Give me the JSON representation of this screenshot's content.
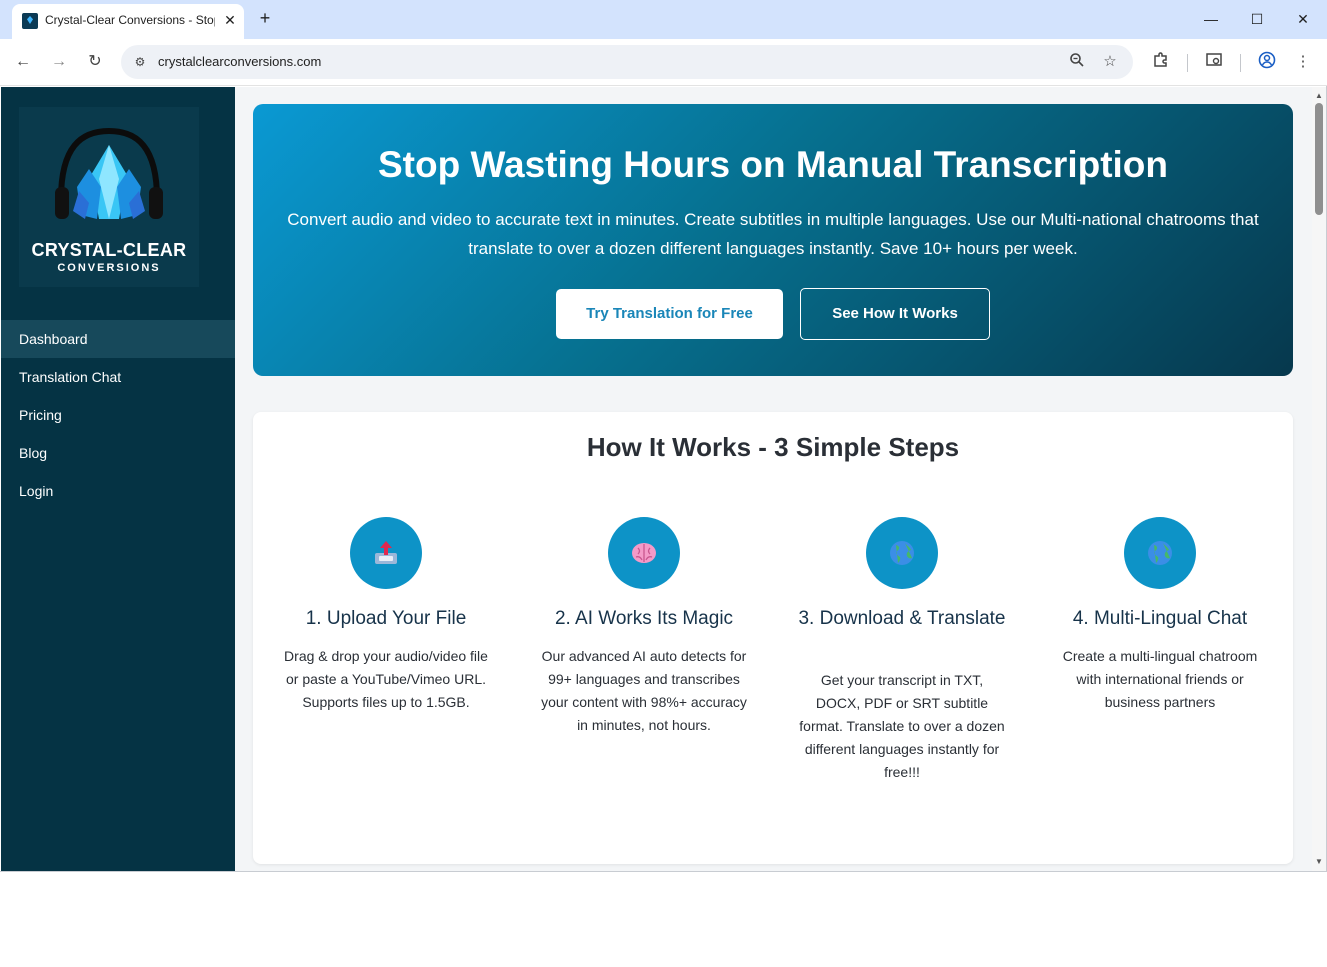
{
  "browser": {
    "tab_title": "Crystal-Clear Conversions - Stop Wasting Hours on Manual Transcription",
    "url": "crystalclearconversions.com"
  },
  "sidebar": {
    "logo_title": "CRYSTAL-CLEAR",
    "logo_subtitle": "CONVERSIONS",
    "items": [
      {
        "label": "Dashboard",
        "active": true
      },
      {
        "label": "Translation Chat"
      },
      {
        "label": "Pricing"
      },
      {
        "label": "Blog"
      },
      {
        "label": "Login"
      }
    ]
  },
  "hero": {
    "title": "Stop Wasting Hours on Manual Transcription",
    "description": "Convert audio and video to accurate text in minutes. Create subtitles in multiple languages. Use our Multi-national chatrooms that translate to over a dozen different languages instantly. Save 10+ hours per week.",
    "primary_button": "Try Translation for Free",
    "secondary_button": "See How It Works"
  },
  "steps": {
    "title": "How It Works - 3 Simple Steps",
    "items": [
      {
        "icon": "upload-tray-icon",
        "title": "1. Upload Your File",
        "description": "Drag & drop your audio/video file or paste a YouTube/Vimeo URL. Supports files up to 1.5GB."
      },
      {
        "icon": "brain-icon",
        "title": "2. AI Works Its Magic",
        "description": "Our advanced AI auto detects for 99+ languages and transcribes your content with 98%+ accuracy in minutes, not hours."
      },
      {
        "icon": "globe-icon",
        "title": "3. Download & Translate",
        "description": "Get your transcript in TXT, DOCX, PDF or SRT subtitle format. Translate to over a dozen different languages instantly for free!!!"
      },
      {
        "icon": "globe-icon",
        "title": "4. Multi-Lingual Chat",
        "description": "Create a multi-lingual chatroom with international friends or business partners"
      }
    ]
  },
  "colors": {
    "sidebar": "#053344",
    "accent": "#0d93c7",
    "hero_start": "#0a99d3",
    "hero_end": "#06384d"
  }
}
